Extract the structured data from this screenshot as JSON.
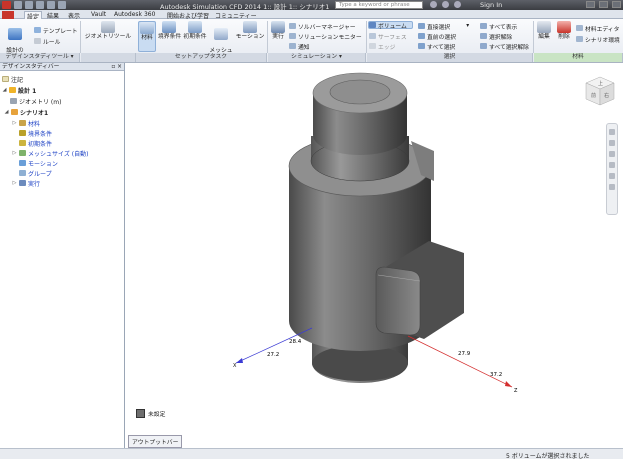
{
  "titlebar": {
    "app_title": "Autodesk Simulation CFD 2014   1:: 設計 1:: シナリオ1",
    "search_placeholder": "Type a keyword or phrase",
    "signin": "Sign In"
  },
  "tabs": [
    "設定",
    "結果",
    "表示",
    "Vault",
    "Autodesk 360",
    "開始および学習",
    "コミュニティー"
  ],
  "ribbon": {
    "design_study": {
      "add_design": "設計の\n追加/更新",
      "template": "テンプレート",
      "rule": "ルール",
      "label": "デザインスタディツール ▾"
    },
    "geometry_tool": "ジオメトリツール",
    "setup": {
      "material": "材料",
      "boundary": "境界条件",
      "initial": "初期条件",
      "mesh": "メッシュ\nサイズ",
      "motion": "モーション",
      "label": "セットアップタスク"
    },
    "simulation": {
      "run": "実行",
      "solver_manager": "ソルバーマネージャー",
      "solution_monitor": "ソリューションモニター",
      "notify": "通知",
      "label": "シミュレーション ▾"
    },
    "selection": {
      "volume": "ボリューム",
      "surface": "サーフェス",
      "edge": "エッジ",
      "direct_select": "直接選択",
      "previous_select": "直前の選択",
      "select_all": "すべて選択",
      "show_all": "すべて表示",
      "deselect": "選択解除",
      "deselect_all": "すべて選択解除",
      "label": "選択"
    },
    "material": {
      "edit": "編集",
      "delete": "削除",
      "material_editor": "材料エディタ",
      "scenario_env": "シナリオ環境",
      "label": "材料"
    }
  },
  "leftpanel": {
    "header": "デザインスタディバー",
    "items": [
      {
        "label": "注記",
        "color": "#222"
      },
      {
        "label": "設計 1",
        "color": "#222"
      },
      {
        "label": "ジオメトリ (m)",
        "color": "#222"
      },
      {
        "label": "シナリオ1",
        "color": "#222"
      },
      {
        "label": "材料",
        "color": "#1a3fc4"
      },
      {
        "label": "境界条件",
        "color": "#1a3fc4"
      },
      {
        "label": "初期条件",
        "color": "#1a3fc4"
      },
      {
        "label": "メッシュサイズ (自動)",
        "color": "#1a3fc4"
      },
      {
        "label": "モーション",
        "color": "#1a3fc4"
      },
      {
        "label": "グループ",
        "color": "#1a3fc4"
      },
      {
        "label": "実行",
        "color": "#1a3fc4"
      }
    ]
  },
  "viewport": {
    "dim_x": "28.4",
    "dim_x2": "27.2",
    "dim_z": "27.9",
    "dim_z2": "37.2",
    "axis_x": "X",
    "axis_z": "Z",
    "legend_label": "未設定",
    "viewcube_front": "前",
    "viewcube_right": "右",
    "viewcube_top": "上"
  },
  "bottom": {
    "output_tab": "アウトプットバー",
    "status": "5 ボリュームが選択されました"
  }
}
